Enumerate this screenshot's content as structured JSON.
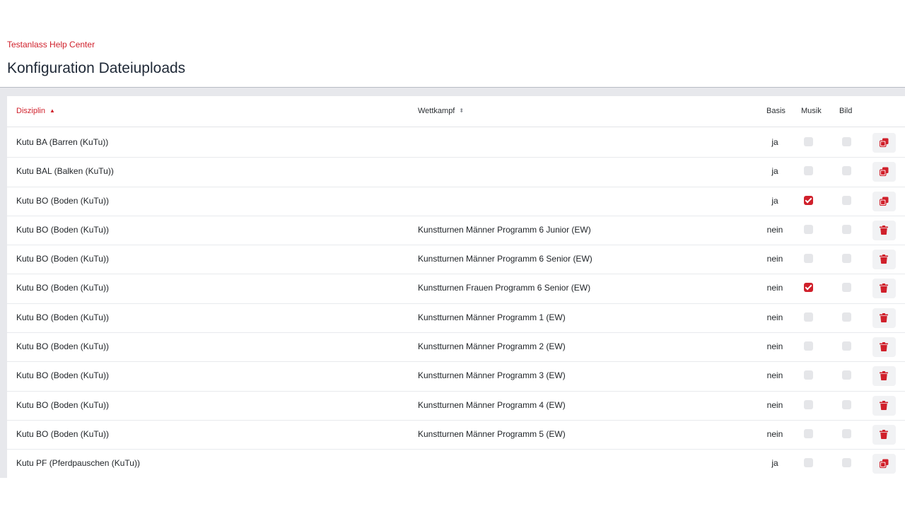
{
  "breadcrumb": "Testanlass Help Center",
  "page_title": "Konfiguration Dateiuploads",
  "colors": {
    "accent": "#d0202b",
    "band": "#e7e8ec",
    "checkbox_off": "#e5e6e9"
  },
  "table": {
    "headers": {
      "disziplin": "Disziplin",
      "wettkampf": "Wettkampf",
      "basis": "Basis",
      "musik": "Musik",
      "bild": "Bild"
    },
    "sort": {
      "disziplin": "ascending",
      "wettkampf": "none"
    },
    "rows": [
      {
        "disziplin": "Kutu BA (Barren (KuTu))",
        "wettkampf": "",
        "basis": "ja",
        "musik": false,
        "bild": false,
        "action": "copy-icon"
      },
      {
        "disziplin": "Kutu BAL (Balken (KuTu))",
        "wettkampf": "",
        "basis": "ja",
        "musik": false,
        "bild": false,
        "action": "copy-icon"
      },
      {
        "disziplin": "Kutu BO (Boden (KuTu))",
        "wettkampf": "",
        "basis": "ja",
        "musik": true,
        "bild": false,
        "action": "copy-icon"
      },
      {
        "disziplin": "Kutu BO (Boden (KuTu))",
        "wettkampf": "Kunstturnen Männer Programm 6 Junior (EW)",
        "basis": "nein",
        "musik": false,
        "bild": false,
        "action": "trash-icon"
      },
      {
        "disziplin": "Kutu BO (Boden (KuTu))",
        "wettkampf": "Kunstturnen Männer Programm 6 Senior (EW)",
        "basis": "nein",
        "musik": false,
        "bild": false,
        "action": "trash-icon"
      },
      {
        "disziplin": "Kutu BO (Boden (KuTu))",
        "wettkampf": "Kunstturnen Frauen Programm 6 Senior (EW)",
        "basis": "nein",
        "musik": true,
        "bild": false,
        "action": "trash-icon"
      },
      {
        "disziplin": "Kutu BO (Boden (KuTu))",
        "wettkampf": "Kunstturnen Männer Programm 1 (EW)",
        "basis": "nein",
        "musik": false,
        "bild": false,
        "action": "trash-icon"
      },
      {
        "disziplin": "Kutu BO (Boden (KuTu))",
        "wettkampf": "Kunstturnen Männer Programm 2 (EW)",
        "basis": "nein",
        "musik": false,
        "bild": false,
        "action": "trash-icon"
      },
      {
        "disziplin": "Kutu BO (Boden (KuTu))",
        "wettkampf": "Kunstturnen Männer Programm 3 (EW)",
        "basis": "nein",
        "musik": false,
        "bild": false,
        "action": "trash-icon"
      },
      {
        "disziplin": "Kutu BO (Boden (KuTu))",
        "wettkampf": "Kunstturnen Männer Programm 4 (EW)",
        "basis": "nein",
        "musik": false,
        "bild": false,
        "action": "trash-icon"
      },
      {
        "disziplin": "Kutu BO (Boden (KuTu))",
        "wettkampf": "Kunstturnen Männer Programm 5 (EW)",
        "basis": "nein",
        "musik": false,
        "bild": false,
        "action": "trash-icon"
      },
      {
        "disziplin": "Kutu PF (Pferdpauschen (KuTu))",
        "wettkampf": "",
        "basis": "ja",
        "musik": false,
        "bild": false,
        "action": "copy-icon"
      }
    ]
  }
}
